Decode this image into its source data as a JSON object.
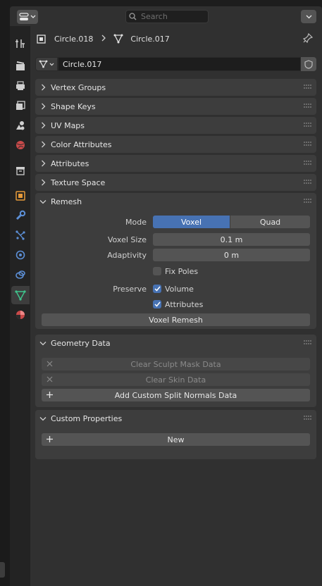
{
  "header": {
    "search_placeholder": "Search"
  },
  "breadcrumb": {
    "object": "Circle.018",
    "mesh": "Circle.017"
  },
  "datablock": {
    "name": "Circle.017"
  },
  "collapsed_panels": [
    "Vertex Groups",
    "Shape Keys",
    "UV Maps",
    "Color Attributes",
    "Attributes",
    "Texture Space"
  ],
  "remesh": {
    "title": "Remesh",
    "mode_label": "Mode",
    "mode_options": [
      "Voxel",
      "Quad"
    ],
    "mode_selected": "Voxel",
    "voxel_size_label": "Voxel Size",
    "voxel_size": "0.1 m",
    "adaptivity_label": "Adaptivity",
    "adaptivity": "0 m",
    "fix_poles_label": "Fix Poles",
    "fix_poles": false,
    "preserve_label": "Preserve",
    "volume_label": "Volume",
    "volume": true,
    "attributes_label": "Attributes",
    "attributes": true,
    "button": "Voxel Remesh"
  },
  "geometry_data": {
    "title": "Geometry Data",
    "clear_sculpt": "Clear Sculpt Mask Data",
    "clear_skin": "Clear Skin Data",
    "add_normals": "Add Custom Split Normals Data"
  },
  "custom_properties": {
    "title": "Custom Properties",
    "new_button": "New"
  },
  "colors": {
    "accent": "#4772b3",
    "panel": "#3d3d3d",
    "background": "#303030",
    "field": "#545454"
  },
  "tabs": [
    "tool-icon",
    "render-icon",
    "output-icon",
    "view-layer-icon",
    "scene-icon",
    "world-icon",
    "collection-icon",
    "object-icon",
    "modifier-icon",
    "particles-icon",
    "physics-icon",
    "constraints-icon",
    "data-icon",
    "material-icon"
  ]
}
